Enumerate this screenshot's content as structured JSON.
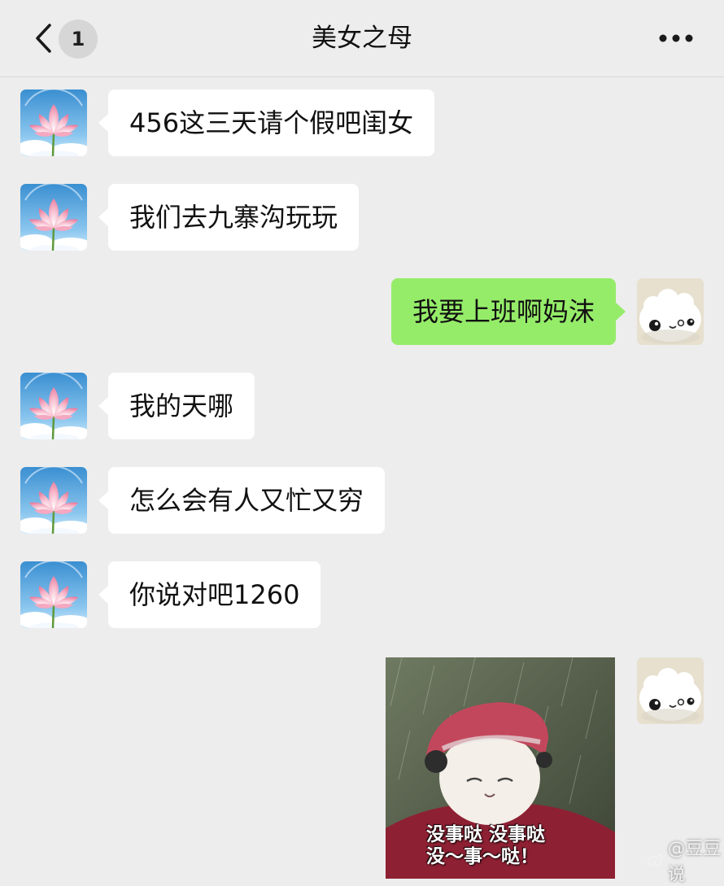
{
  "header": {
    "title": "美女之母",
    "unread_count": "1",
    "back_icon": "chevron-left-icon",
    "more_icon": "ellipsis-icon"
  },
  "messages": [
    {
      "direction": "incoming",
      "text": "456这三天请个假吧闺女"
    },
    {
      "direction": "incoming",
      "text": "我们去九寨沟玩玩"
    },
    {
      "direction": "outgoing",
      "text": "我要上班啊妈沫"
    },
    {
      "direction": "incoming",
      "text": "我的天哪"
    },
    {
      "direction": "incoming",
      "text": "怎么会有人又忙又穷"
    },
    {
      "direction": "incoming",
      "text": "你说对吧1260"
    },
    {
      "direction": "outgoing",
      "type": "sticker",
      "caption_line1": "没事哒 没事哒",
      "caption_line2": "没～事～哒！"
    }
  ],
  "watermark": {
    "text": "@豆豆说",
    "icon": "weibo-icon"
  },
  "colors": {
    "background": "#ededed",
    "incoming_bubble": "#ffffff",
    "outgoing_bubble": "#95ec69"
  }
}
